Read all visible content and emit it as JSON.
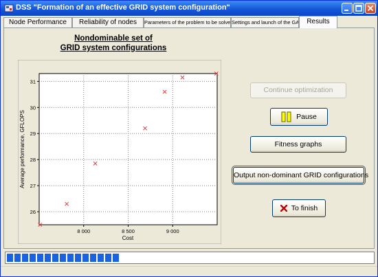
{
  "window": {
    "title": "DSS \"Formation of an effective GRID system configuration\"",
    "icon": "app-icon"
  },
  "tabs": [
    {
      "label": "Node Performance",
      "active": false
    },
    {
      "label": "Reliability of nodes",
      "active": false
    },
    {
      "label": "Parameters of the problem to be solved",
      "active": false
    },
    {
      "label": "Settings and launch of the GA",
      "active": false
    },
    {
      "label": "Results",
      "active": true
    }
  ],
  "results": {
    "heading_line1": "Nondominable set of",
    "heading_line2": "GRID system configurations",
    "buttons": {
      "continue_optimization": "Continue optimization",
      "pause": "Pause",
      "fitness_graphs": "Fitness graphs",
      "output_non_dominant": "Output non-dominant GRID configurations",
      "to_finish": "To finish"
    }
  },
  "progress": {
    "fraction": 0.31
  },
  "colors": {
    "marker": "#e04040",
    "titlebar": "#1658d8",
    "progress": "#1a62e0",
    "pause_icon": "#ffff00"
  },
  "chart_data": {
    "type": "scatter",
    "title": "",
    "xlabel": "Cost",
    "ylabel": "Average performance, GFLOPS",
    "xlim": [
      7500,
      9500
    ],
    "ylim": [
      25.5,
      31.3
    ],
    "xticks": [
      8000,
      8500,
      9000
    ],
    "xtick_labels": [
      "8 000",
      "8 500",
      "9 000"
    ],
    "yticks": [
      26,
      27,
      28,
      29,
      30,
      31
    ],
    "ytick_labels": [
      "26",
      "27",
      "28",
      "29",
      "30",
      "31"
    ],
    "grid": true,
    "marker": "x",
    "points": [
      {
        "x": 7510,
        "y": 25.5
      },
      {
        "x": 7810,
        "y": 26.3
      },
      {
        "x": 8130,
        "y": 27.85
      },
      {
        "x": 8690,
        "y": 29.2
      },
      {
        "x": 8910,
        "y": 30.6
      },
      {
        "x": 9110,
        "y": 31.15
      },
      {
        "x": 9490,
        "y": 31.3
      }
    ]
  }
}
